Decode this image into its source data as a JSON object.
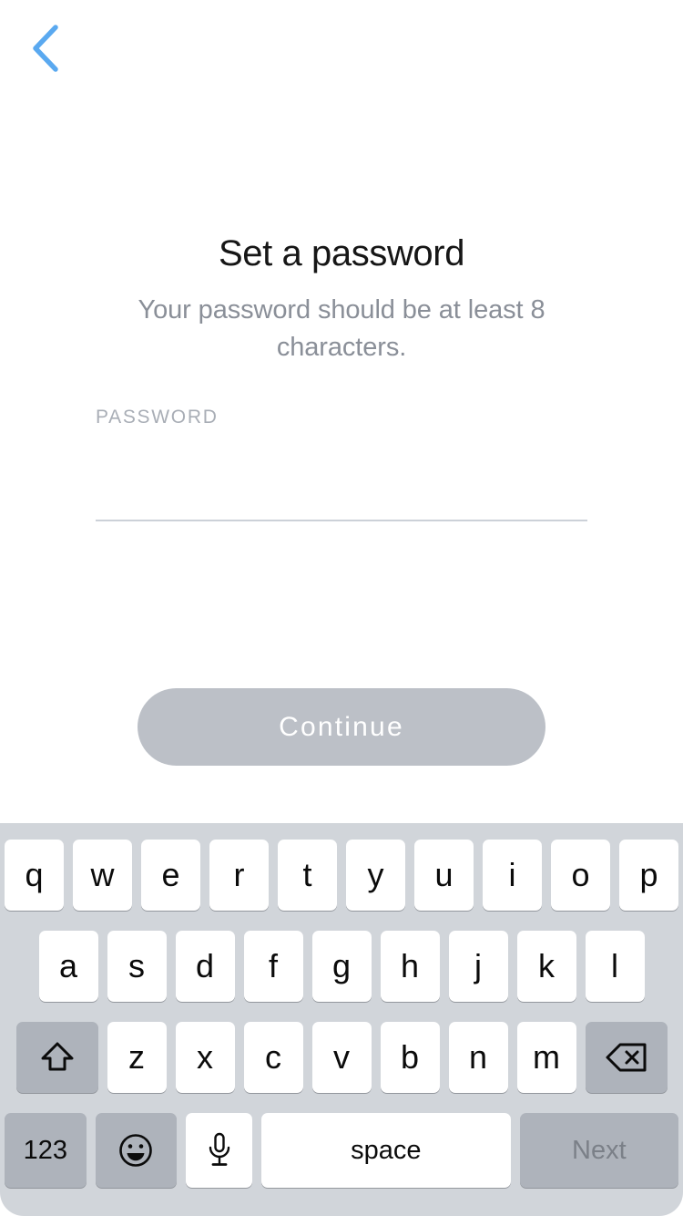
{
  "nav": {
    "back_icon": "chevron-left-icon",
    "back_color": "#5aa9f0"
  },
  "header": {
    "title": "Set a password",
    "subtitle": "Your password should be at least 8 characters."
  },
  "form": {
    "password_label": "PASSWORD",
    "password_value": "",
    "password_placeholder": "",
    "underline_color": "#ccd1d8"
  },
  "actions": {
    "continue_label": "Continue",
    "continue_enabled": false,
    "continue_bg": "#bcc0c7",
    "continue_text_color": "#ffffff"
  },
  "keyboard": {
    "background": "#d1d5da",
    "key_bg": "#ffffff",
    "modifier_key_bg": "#aeb3bb",
    "row1": [
      "q",
      "w",
      "e",
      "r",
      "t",
      "y",
      "u",
      "i",
      "o",
      "p"
    ],
    "row2": [
      "a",
      "s",
      "d",
      "f",
      "g",
      "h",
      "j",
      "k",
      "l"
    ],
    "row3": [
      "z",
      "x",
      "c",
      "v",
      "b",
      "n",
      "m"
    ],
    "shift_icon": "shift-arrow-icon",
    "backspace_icon": "backspace-delete-icon",
    "numbers_label": "123",
    "emoji_icon": "smiley-face-icon",
    "dictation_icon": "microphone-icon",
    "space_label": "space",
    "next_label": "Next"
  }
}
